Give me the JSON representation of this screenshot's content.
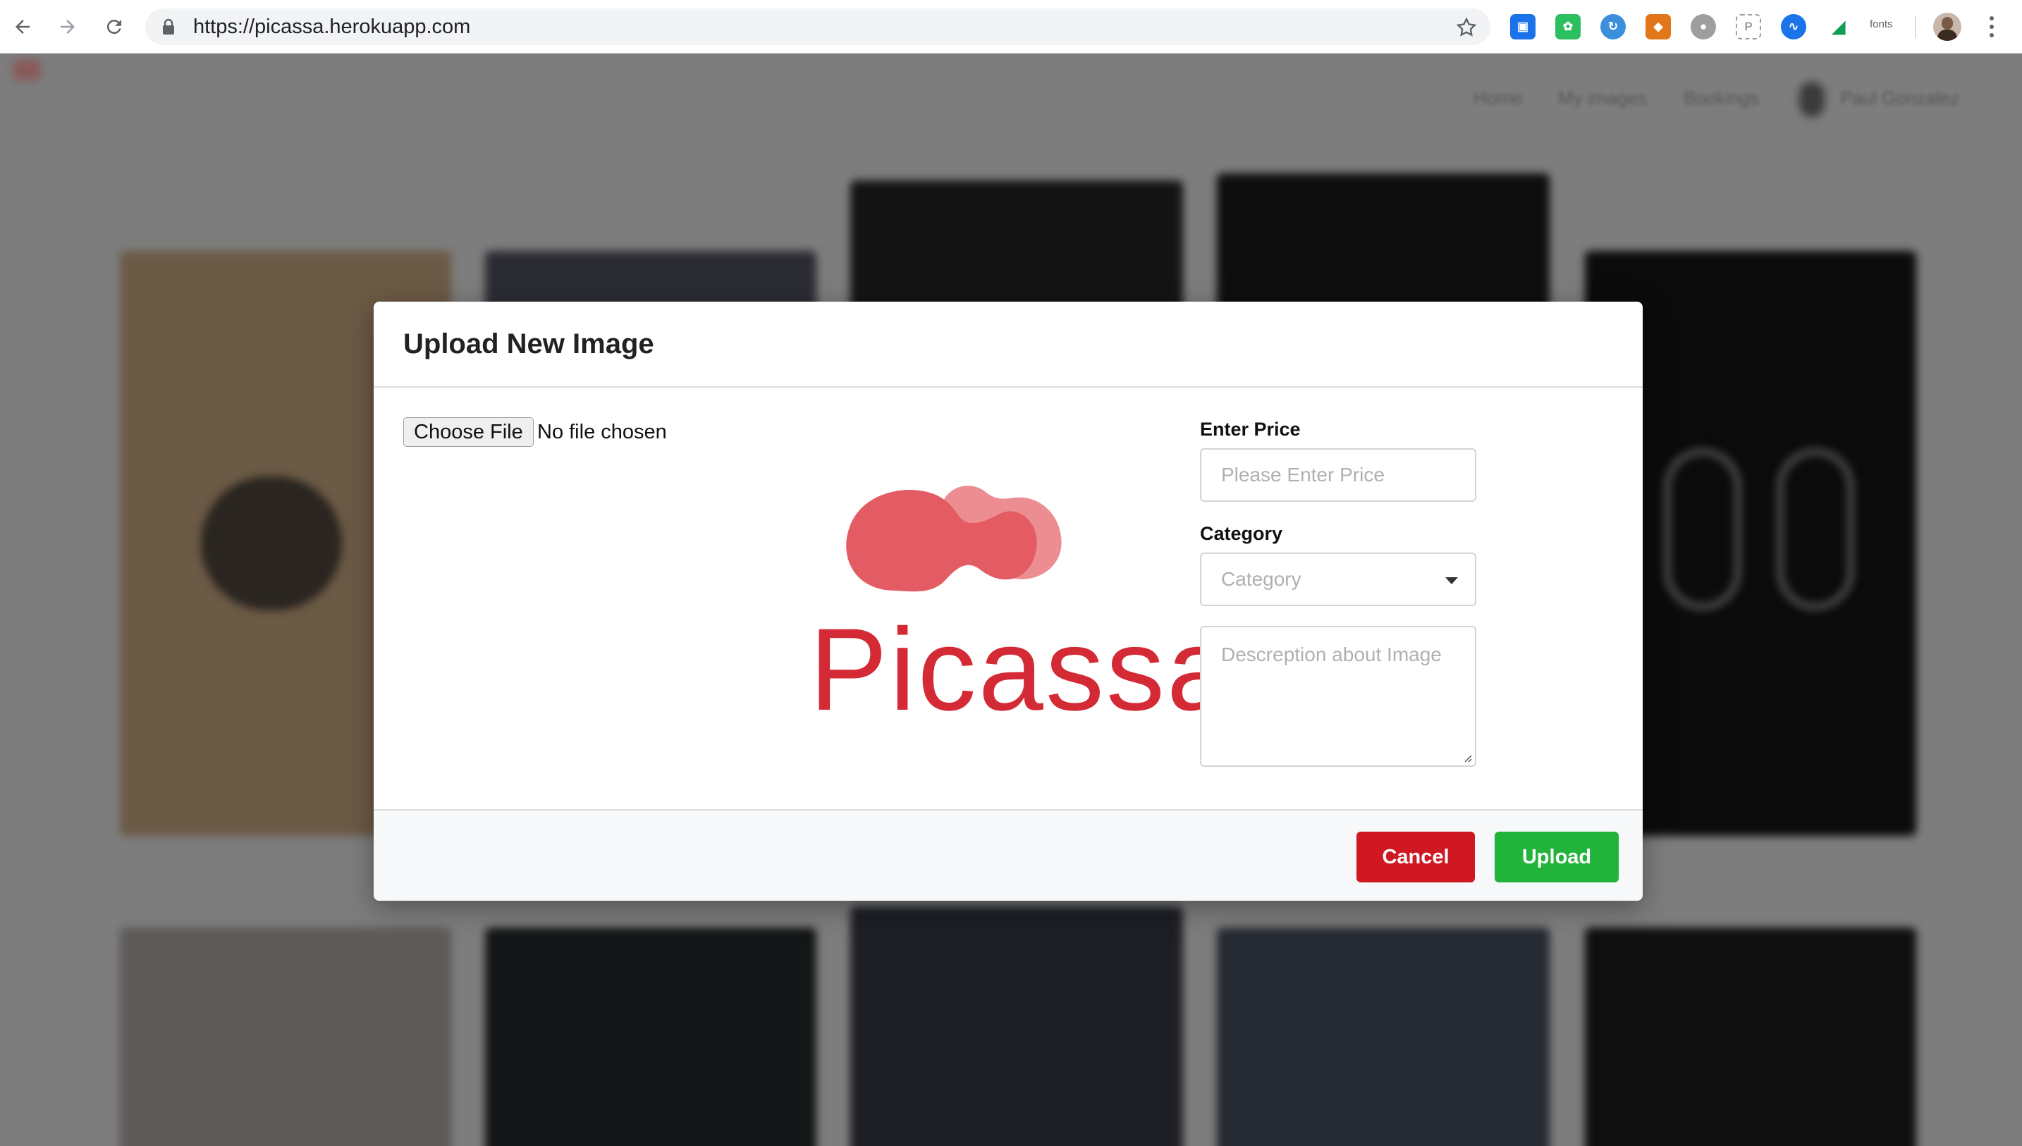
{
  "browser": {
    "url": "https://picassa.herokuapp.com",
    "extensions_label": "fonts"
  },
  "background_page": {
    "nav_items": [
      "Home",
      "My images",
      "Bookings",
      "Paul Gonzalez"
    ]
  },
  "modal": {
    "title": "Upload New Image",
    "file_input": {
      "button_label": "Choose File",
      "status": "No file chosen"
    },
    "logo_text": "Picassa",
    "price": {
      "label": "Enter Price",
      "placeholder": "Please Enter Price"
    },
    "category": {
      "label": "Category",
      "selected": "Category"
    },
    "description": {
      "placeholder": "Descreption about Image"
    },
    "buttons": {
      "cancel": "Cancel",
      "upload": "Upload"
    }
  },
  "colors": {
    "brand_red": "#d42a35",
    "cancel": "#d01822",
    "upload": "#22b43a"
  }
}
